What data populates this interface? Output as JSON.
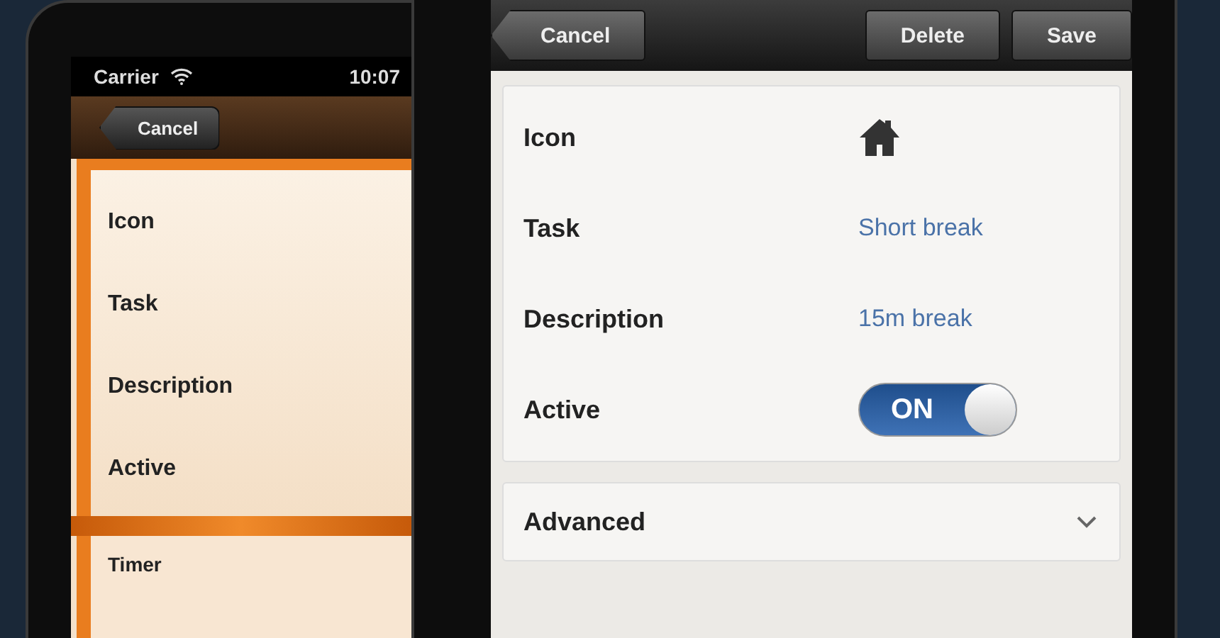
{
  "left_screen": {
    "status_bar": {
      "carrier": "Carrier",
      "time": "10:07"
    },
    "nav_bar": {
      "cancel": "Cancel"
    },
    "rows": [
      {
        "label": "Icon"
      },
      {
        "label": "Task"
      },
      {
        "label": "Description"
      },
      {
        "label": "Active"
      }
    ],
    "section": {
      "label": "Timer"
    }
  },
  "right_screen": {
    "nav_bar": {
      "buttons": [
        {
          "label": "Cancel",
          "kind": "back"
        },
        {
          "label": "Delete",
          "kind": "plain"
        },
        {
          "label": "Save",
          "kind": "plain"
        }
      ]
    },
    "rows": [
      {
        "label": "Icon",
        "kind": "icon"
      },
      {
        "label": "Task",
        "kind": "text",
        "value": "Short break"
      },
      {
        "label": "Description",
        "kind": "text",
        "value": "15m break"
      },
      {
        "label": "Active",
        "kind": "toggle",
        "on": true,
        "toggle_label": "ON"
      }
    ],
    "advanced": {
      "label": "Advanced"
    }
  }
}
